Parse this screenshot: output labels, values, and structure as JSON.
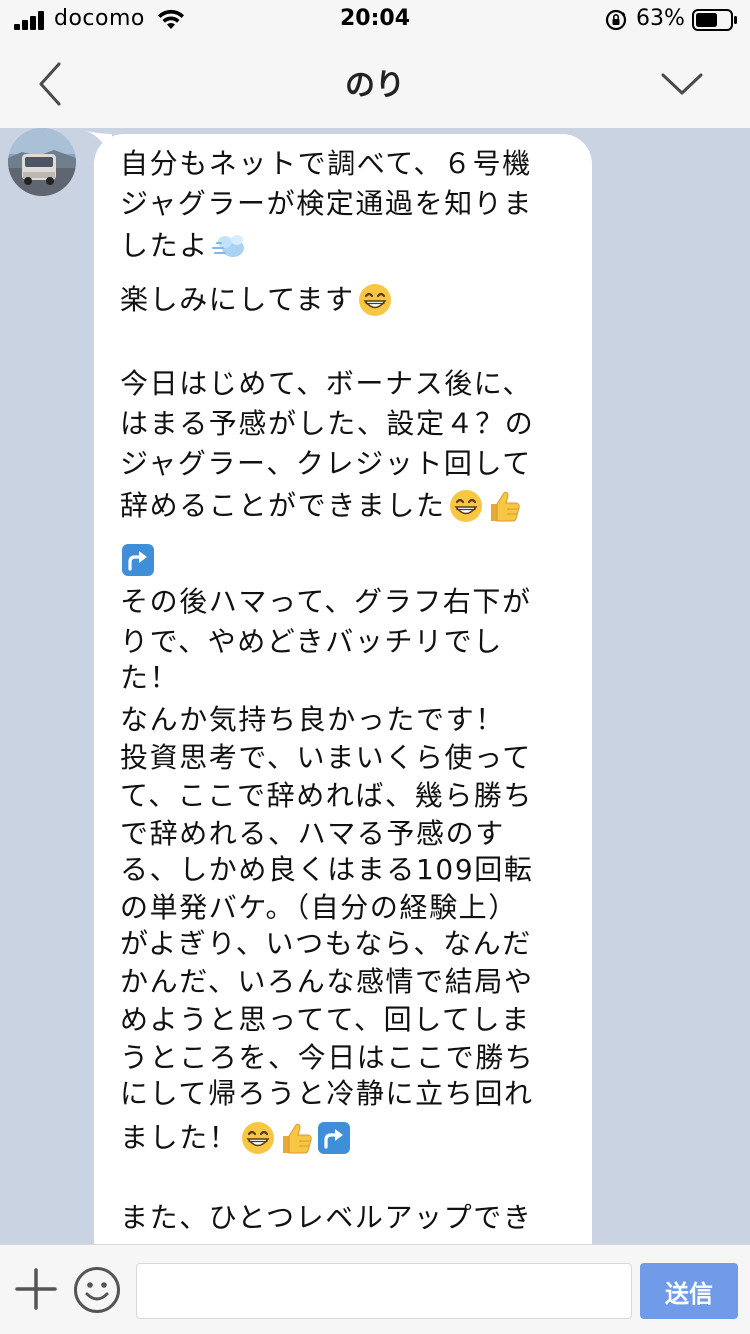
{
  "status_bar": {
    "carrier": "docomo",
    "time": "20:04",
    "battery_percent": "63%"
  },
  "header": {
    "title": "のり"
  },
  "message": {
    "sender": "のり",
    "lines": [
      "自分もネットで調べて、６号機",
      "ジャグラーが検定通過を知りま",
      "したよ",
      "楽しみにしてます",
      "",
      "今日はじめて、ボーナス後に、",
      "はまる予感がした、設定４？の",
      "ジャグラー、クレジット回して",
      "辞めることができました",
      "",
      "その後ハマって、グラフ右下が",
      "りで、やめどきバッチリでし",
      "た！",
      "なんか気持ち良かったです！",
      "投資思考で、いまいくら使って",
      "て、ここで辞めれば、幾ら勝ち",
      "で辞めれる、ハマる予感のす",
      "る、しかめ良くはまる109回転",
      "の単発バケ。（自分の経験上）",
      "がよぎり、いつもなら、なんだ",
      "かんだ、いろんな感情で結局や",
      "めようと思ってて、回してしま",
      "うところを、今日はここで勝ち",
      "にして帰ろうと冷静に立ち回れ",
      "ました！",
      "",
      "また、ひとつレベルアップでき"
    ],
    "emojis": {
      "line_3": [
        "dash-emoji"
      ],
      "line_4": [
        "grin-emoji"
      ],
      "line_9": [
        "grin-emoji",
        "thumbs-up-emoji"
      ],
      "line_10": [
        "up-arrow-emoji"
      ],
      "line_25": [
        "grin-emoji",
        "thumbs-up-emoji",
        "up-arrow-emoji"
      ]
    }
  },
  "input_bar": {
    "placeholder": "",
    "send_label": "送信"
  },
  "colors": {
    "chat_background": "#c9d3e1",
    "bubble": "#ffffff",
    "send_button": "#6f9be8"
  }
}
